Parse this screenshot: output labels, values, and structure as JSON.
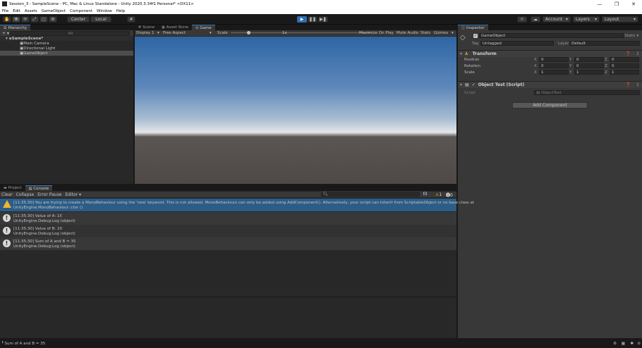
{
  "window": {
    "title": "Session_3 - SampleScene - PC, Mac & Linux Standalone - Unity 2020.3.34f1 Personal* <DX11>",
    "minimize": "—",
    "restore": "❐",
    "close": "✕"
  },
  "menu": [
    "File",
    "Edit",
    "Assets",
    "GameObject",
    "Component",
    "Window",
    "Help"
  ],
  "toolbar": {
    "center": "Center",
    "local": "Local",
    "account": "Account",
    "layers": "Layers",
    "layout": "Layout",
    "tools": [
      "✋",
      "✥",
      "⟳",
      "⤢",
      "▢",
      "⚙"
    ],
    "play": "▶",
    "pause": "❚❚",
    "step": "▶❚",
    "accent": "#2f6fb1"
  },
  "hierarchy": {
    "tab": "Hierarchy",
    "add": "+ ▾",
    "search_placeholder": "All",
    "scene": "SampleScene*",
    "items": [
      "Main Camera",
      "Directional Light",
      "GameObject"
    ]
  },
  "game": {
    "tabs": [
      "Scene",
      "Asset Store",
      "Game"
    ],
    "display": "Display 1",
    "aspect": "Free Aspect",
    "scale_label": "Scale",
    "scale_value": "1x",
    "right_buttons": [
      "Maximize On Play",
      "Mute Audio",
      "Stats",
      "Gizmos"
    ],
    "scale_fraction": 0.25
  },
  "inspector": {
    "tab": "Inspector",
    "object_name": "GameObject",
    "static": "Static",
    "tag_label": "Tag",
    "tag_value": "Untagged",
    "layer_label": "Layer",
    "layer_value": "Default",
    "transform": {
      "title": "Transform",
      "rows": [
        {
          "label": "Position",
          "x": "0",
          "y": "0",
          "z": "0"
        },
        {
          "label": "Rotation",
          "x": "0",
          "y": "0",
          "z": "0"
        },
        {
          "label": "Scale",
          "x": "1",
          "y": "1",
          "z": "1"
        }
      ]
    },
    "script": {
      "title": "Object Test (Script)",
      "label": "Script",
      "value": "ObjectTest"
    },
    "add_component": "Add Component"
  },
  "console": {
    "tabs": [
      "Project",
      "Console"
    ],
    "buttons": [
      "Clear",
      "Collapse",
      "Error Pause",
      "Editor ▾"
    ],
    "counts": {
      "info": "3",
      "warn": "1",
      "error": "0"
    },
    "messages": [
      {
        "kind": "warn",
        "line1": "[11:35:30] You are trying to create a MonoBehaviour using the 'new' keyword.  This is not allowed.  MonoBehaviours can only be added using AddComponent(). Alternatively, your script can inherit from ScriptableObject or no base class at",
        "line2": "UnityEngine.MonoBehaviour:.ctor ()"
      },
      {
        "kind": "info",
        "line1": "[11:35:30] Value of A: 15",
        "line2": "UnityEngine.Debug:Log (object)"
      },
      {
        "kind": "info",
        "line1": "[11:35:30] Value of B: 20",
        "line2": "UnityEngine.Debug:Log (object)"
      },
      {
        "kind": "info",
        "line1": "[11:35:30] Sum of A and B = 35",
        "line2": "UnityEngine.Debug:Log (object)"
      }
    ]
  },
  "status": {
    "text": "Sum of A and B = 35"
  }
}
